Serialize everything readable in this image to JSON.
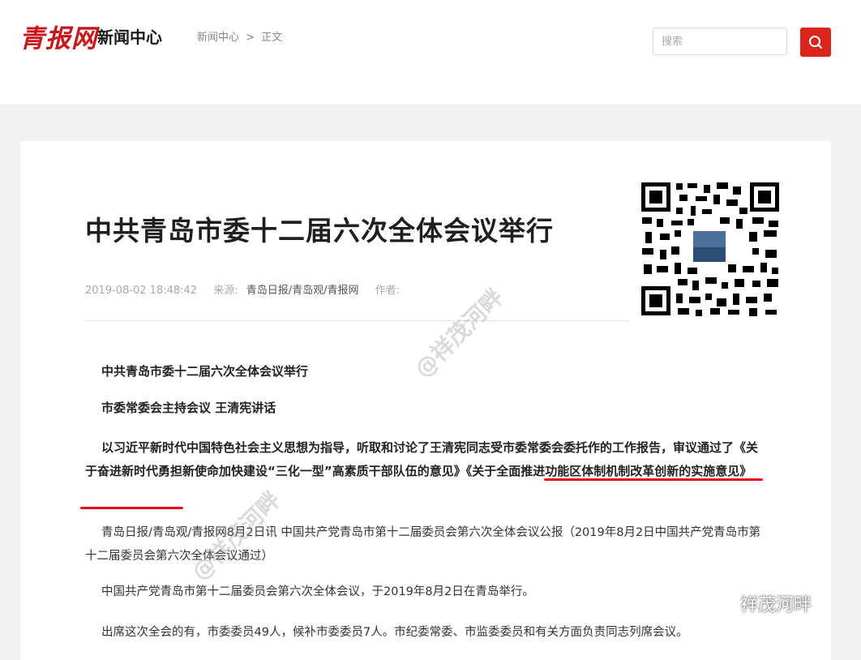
{
  "header": {
    "logo": "青报网",
    "section_title": "新闻中心",
    "breadcrumb": [
      "新闻中心",
      ">",
      "正文"
    ],
    "search_placeholder": "搜索"
  },
  "article": {
    "title": "中共青岛市委十二届六次全体会议举行",
    "datetime": "2019-08-02 18:48:42",
    "source_label": "来源:",
    "source": "青岛日报/青岛观/青报网",
    "author_label": "作者:",
    "paragraphs": {
      "p1": "中共青岛市委十二届六次全体会议举行",
      "p2": "市委常委会主持会议 王清宪讲话",
      "p3": "以习近平新时代中国特色社会主义思想为指导，听取和讨论了王清宪同志受市委常委会委托作的工作报告，审议通过了《关于奋进新时代勇担新使命加快建设“三化一型”高素质干部队伍的意见》《关于全面推进功能区体制机制改革创新的实施意见》",
      "p4": "青岛日报/青岛观/青报网8月2日讯 中国共产党青岛市第十二届委员会第六次全体会议公报（2019年8月2日中国共产党青岛市第十二届委员会第六次全体会议通过）",
      "p5": "中国共产党青岛市第十二届委员会第六次全体会议，于2019年8月2日在青岛举行。",
      "p6": "出席这次全会的有，市委委员49人，候补市委委员7人。市纪委常委、市监委委员和有关方面负责同志列席会议。"
    }
  },
  "watermarks": {
    "diag": "@祥茂河畔",
    "wechat": "祥茂河畔"
  },
  "colors": {
    "accent": "#d9251c",
    "underline": "#e0101b"
  }
}
